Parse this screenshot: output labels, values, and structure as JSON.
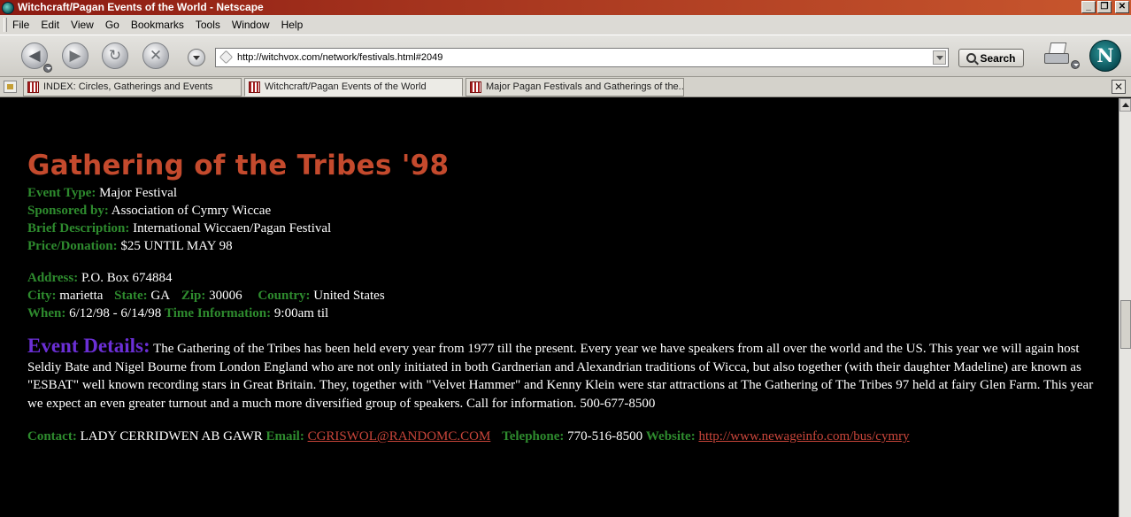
{
  "window": {
    "title": "Witchcraft/Pagan Events of the World - Netscape"
  },
  "menu": {
    "items": [
      "File",
      "Edit",
      "View",
      "Go",
      "Bookmarks",
      "Tools",
      "Window",
      "Help"
    ]
  },
  "toolbar": {
    "url": "http://witchvox.com/network/festivals.html#2049",
    "search_label": "Search"
  },
  "tabs": [
    {
      "label": "INDEX: Circles, Gatherings and Events"
    },
    {
      "label": "Witchcraft/Pagan Events of the World"
    },
    {
      "label": "Major Pagan Festivals and Gatherings of the..."
    }
  ],
  "event": {
    "title": "Gathering of the Tribes '98",
    "type_label": "Event Type:",
    "type": "Major Festival",
    "sponsor_label": "Sponsored by:",
    "sponsor": "Association of Cymry Wiccae",
    "description_label": "Brief Description:",
    "description": "International Wiccaen/Pagan Festival",
    "price_label": "Price/Donation:",
    "price": "$25 UNTIL MAY 98",
    "address_label": "Address:",
    "address": "P.O. Box 674884",
    "city_label": "City:",
    "city": "marietta",
    "state_label": "State:",
    "state": "GA",
    "zip_label": "Zip:",
    "zip": "30006",
    "country_label": "Country:",
    "country": "United States",
    "when_label": "When:",
    "when": "6/12/98 - 6/14/98",
    "time_label": "Time Information:",
    "time": "9:00am til",
    "details_label": "Event Details:",
    "details": "The Gathering of the Tribes has been held every year from 1977 till the present. Every year we have speakers from all over the world and the US. This year we will again host Seldiy Bate and Nigel Bourne from London England who are not only initiated in both Gardnerian and Alexandrian traditions of Wicca, but also together (with their daughter Madeline) are known as \"ESBAT\" well known recording stars in Great Britain. They, together with \"Velvet Hammer\" and Kenny Klein were star attractions at The Gathering of The Tribes 97 held at fairy Glen Farm. This year we expect an even greater turnout and a much more diversified group of speakers. Call for information. 500-677-8500",
    "contact_label": "Contact:",
    "contact": "LADY CERRIDWEN AB GAWR",
    "email_label": "Email:",
    "email": "CGRISWOL@RANDOMC.COM",
    "phone_label": "Telephone:",
    "phone": "770-516-8500",
    "website_label": "Website:",
    "website": "http://www.newageinfo.com/bus/cymry"
  },
  "colors": {
    "title": "#c44a2d",
    "label": "#2e8b2e",
    "details_label": "#6b2fd6",
    "link": "#c8453a",
    "background": "#000000"
  }
}
